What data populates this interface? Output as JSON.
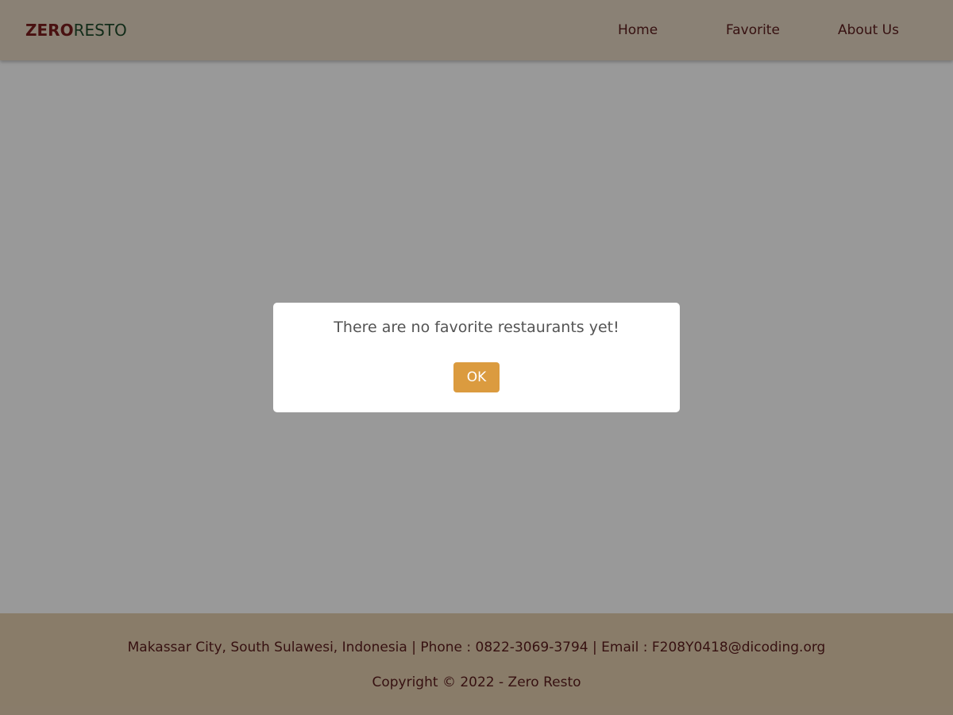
{
  "header": {
    "logo_part1": "ZERO",
    "logo_part2": "RESTO",
    "nav": {
      "home": "Home",
      "favorite": "Favorite",
      "about": "About Us"
    }
  },
  "footer": {
    "contact": "Makassar City, South Sulawesi, Indonesia | Phone : 0822-3069-3794 | Email : F208Y0418@dicoding.org",
    "copyright": "Copyright © 2022 - Zero Resto"
  },
  "modal": {
    "message": "There are no favorite restaurants yet!",
    "ok_label": "OK"
  },
  "colors": {
    "header_bg": "#e6d8c4",
    "footer_bg": "#e4cfb0",
    "text_maroon": "#5a1c1c",
    "logo_red": "#7a1d1d",
    "logo_green": "#1f4a2b",
    "ok_button": "#db9b3f"
  }
}
